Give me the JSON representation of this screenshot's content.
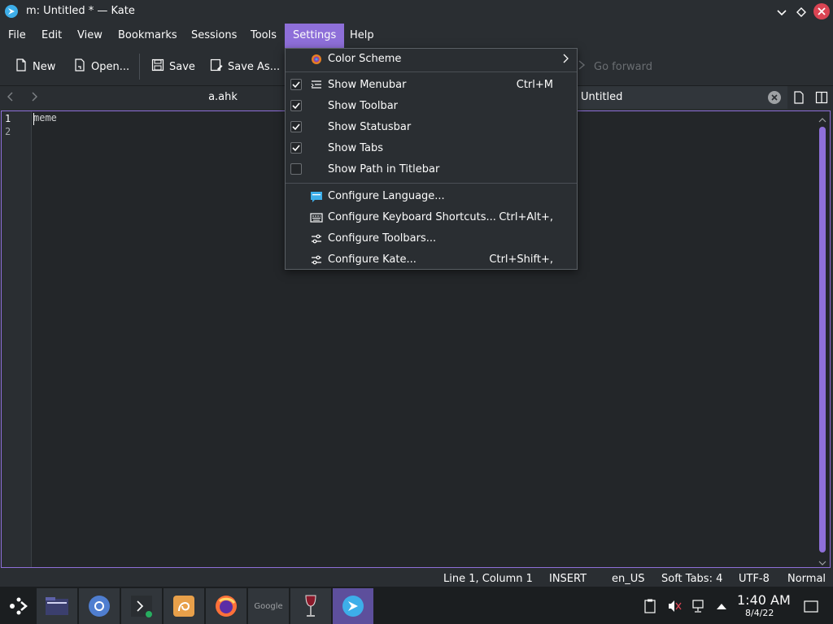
{
  "window": {
    "title": "m: Untitled * — Kate"
  },
  "menubar": {
    "items": [
      "File",
      "Edit",
      "View",
      "Bookmarks",
      "Sessions",
      "Tools",
      "Settings",
      "Help"
    ],
    "active": "Settings"
  },
  "toolbar": {
    "new": "New",
    "open": "Open...",
    "save": "Save",
    "save_as": "Save As...",
    "go_forward": "Go forward"
  },
  "tabs": [
    {
      "label": "a.ahk"
    },
    {
      "label": "Untitled",
      "active": true
    }
  ],
  "editor": {
    "line_numbers": [
      "1",
      "2"
    ],
    "lines": [
      "meme",
      ""
    ]
  },
  "status": {
    "position": "Line 1, Column 1",
    "mode": "INSERT",
    "language": "en_US",
    "indent": "Soft Tabs: 4",
    "encoding": "UTF-8",
    "input_mode": "Normal"
  },
  "settings_menu": {
    "color_scheme": "Color Scheme",
    "show_menubar": {
      "label": "Show Menubar",
      "shortcut": "Ctrl+M",
      "checked": true
    },
    "show_toolbar": {
      "label": "Show Toolbar",
      "checked": true
    },
    "show_statusbar": {
      "label": "Show Statusbar",
      "checked": true
    },
    "show_tabs": {
      "label": "Show Tabs",
      "checked": true
    },
    "show_path": {
      "label": "Show Path in Titlebar",
      "checked": false
    },
    "configure_language": "Configure Language...",
    "configure_shortcuts": {
      "label": "Configure Keyboard Shortcuts...",
      "shortcut": "Ctrl+Alt+,"
    },
    "configure_toolbars": "Configure Toolbars...",
    "configure_kate": {
      "label": "Configure Kate...",
      "shortcut": "Ctrl+Shift+,"
    }
  },
  "taskbar": {
    "apps": [
      "launcher-icon",
      "file-manager-icon",
      "chromium-icon",
      "konsole-icon",
      "meld-icon",
      "firefox-icon",
      "google-icon",
      "wine-icon",
      "kate-icon"
    ],
    "google_label": "Google",
    "clock_time": "1:40 AM",
    "clock_date": "8/4/22"
  },
  "colors": {
    "accent": "#8e6fd9",
    "background": "#2a2e32",
    "editor_bg": "#232629",
    "close_red": "#da4453"
  }
}
